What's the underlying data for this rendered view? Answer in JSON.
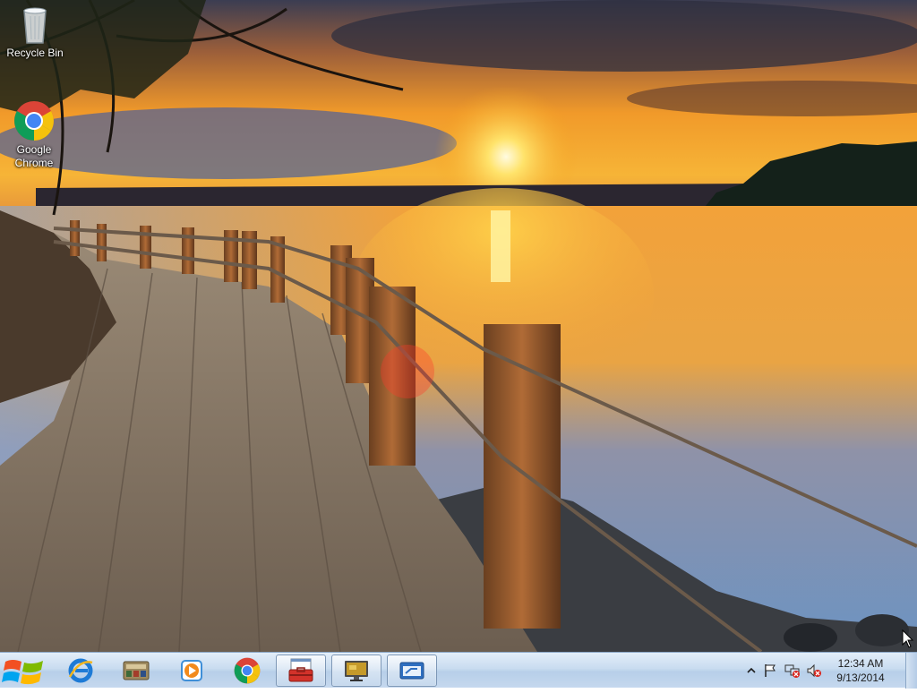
{
  "desktop": {
    "icons": [
      {
        "label": "Recycle Bin",
        "icon": "recycle-bin-icon"
      },
      {
        "label": "Google\nChrome",
        "icon": "chrome-icon"
      }
    ]
  },
  "taskbar": {
    "start": {
      "icon": "windows-logo-icon"
    },
    "pinned": [
      {
        "icon": "internet-explorer-icon",
        "open": false
      },
      {
        "icon": "control-panel-icon",
        "open": false
      },
      {
        "icon": "media-player-icon",
        "open": false
      },
      {
        "icon": "chrome-icon",
        "open": false
      },
      {
        "icon": "toolbox-icon",
        "open": true
      },
      {
        "icon": "monitor-icon",
        "open": true
      },
      {
        "icon": "window-icon",
        "open": true
      }
    ],
    "tray": {
      "icons": [
        "show-hidden-icons-chevron",
        "action-center-flag-icon",
        "network-icon",
        "volume-muted-icon"
      ],
      "time": "12:34 AM",
      "date": "9/13/2014"
    }
  },
  "colors": {
    "taskbar_top": "#e3eef9",
    "taskbar_bottom": "#b7cfe9",
    "sky_orange": "#f39a1e",
    "water_blue": "#5f86b4"
  }
}
